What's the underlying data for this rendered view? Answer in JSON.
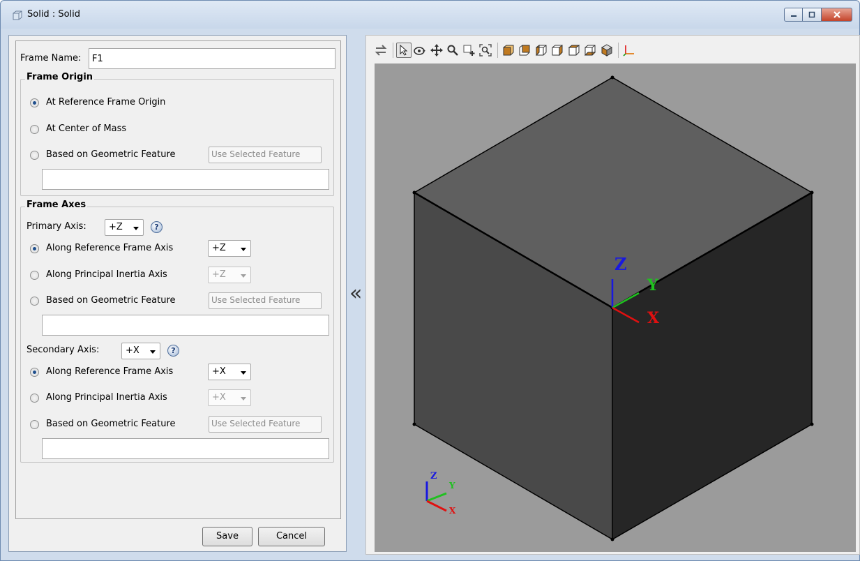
{
  "window": {
    "title": "Solid : Solid"
  },
  "form": {
    "frame_name_label": "Frame Name:",
    "frame_name_value": "F1",
    "frame_origin": {
      "title": "Frame Origin",
      "options": [
        {
          "label": "At Reference Frame Origin",
          "checked": true
        },
        {
          "label": "At Center of Mass",
          "checked": false
        },
        {
          "label": "Based on Geometric Feature",
          "checked": false
        }
      ],
      "use_selected_label": "Use Selected Feature",
      "feature_value": ""
    },
    "frame_axes": {
      "title": "Frame Axes",
      "primary": {
        "label": "Primary Axis:",
        "value": "+Z",
        "help": "?",
        "options": [
          {
            "label": "Along Reference Frame Axis",
            "checked": true,
            "dropdown": "+Z",
            "enabled": true
          },
          {
            "label": "Along Principal Inertia Axis",
            "checked": false,
            "dropdown": "+Z",
            "enabled": false
          },
          {
            "label": "Based on Geometric Feature",
            "checked": false
          }
        ],
        "use_selected_label": "Use Selected Feature",
        "feature_value": ""
      },
      "secondary": {
        "label": "Secondary Axis:",
        "value": "+X",
        "help": "?",
        "options": [
          {
            "label": "Along Reference Frame Axis",
            "checked": true,
            "dropdown": "+X",
            "enabled": true
          },
          {
            "label": "Along Principal Inertia Axis",
            "checked": false,
            "dropdown": "+X",
            "enabled": false
          },
          {
            "label": "Based on Geometric Feature",
            "checked": false
          }
        ],
        "use_selected_label": "Use Selected Feature",
        "feature_value": ""
      }
    },
    "save_label": "Save",
    "cancel_label": "Cancel"
  },
  "collapse_glyph": "«",
  "viewport": {
    "axis_labels": {
      "x": "X",
      "y": "Y",
      "z": "Z"
    },
    "colors": {
      "x": "#e01010",
      "y": "#20c020",
      "z": "#1818e0",
      "background": "#9b9b9b"
    }
  }
}
